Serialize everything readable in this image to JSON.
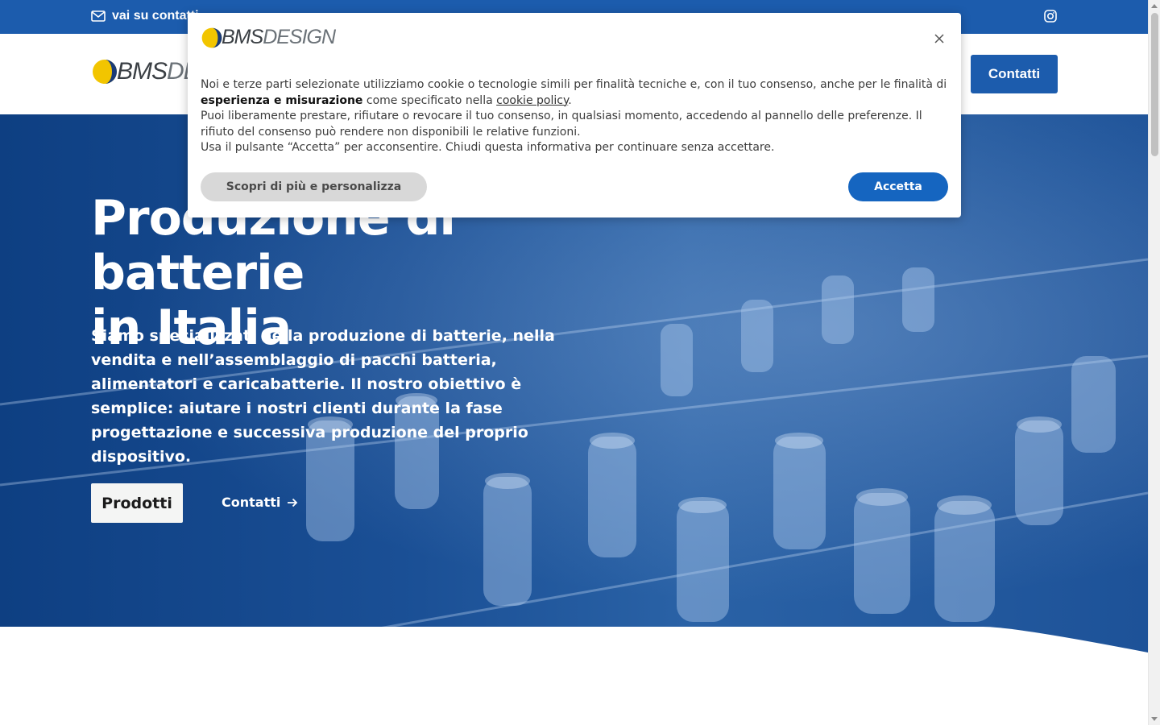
{
  "topbar": {
    "contact_label": "vai su contatti",
    "contact_icon": "envelope-icon",
    "social_icon": "instagram-icon"
  },
  "header": {
    "logo_text_bold": "BMS",
    "logo_text_light": "DESIGN",
    "cta_label": "Contatti"
  },
  "hero": {
    "title_line1": "Produzione di batterie",
    "title_line2": "in Italia",
    "lead": "Siamo specializzati nella produzione di batterie, nella vendita e nell’assemblaggio di pacchi batteria, alimentatori e caricabatterie. Il nostro obiettivo è semplice: aiutare i nostri clienti durante la fase progettazione e successiva produzione del proprio dispositivo.",
    "primary_button": "Prodotti",
    "secondary_link": "Contatti",
    "secondary_icon": "arrow-right-icon"
  },
  "cookie_banner": {
    "logo_text_bold": "BMS",
    "logo_text_light": "DESIGN",
    "close_icon": "close-icon",
    "text_part1": "Noi e terze parti selezionate utilizziamo cookie o tecnologie simili per finalità tecniche e, con il tuo consenso, anche per le finalità di ",
    "text_bold": "esperienza e misurazione",
    "text_part2": " come specificato nella ",
    "text_link": "cookie policy",
    "text_part3": ".",
    "text_line2": "Puoi liberamente prestare, rifiutare o revocare il tuo consenso, in qualsiasi momento, accedendo al pannello delle preferenze. Il rifiuto del consenso può rendere non disponibili le relative funzioni.",
    "text_line3": "Usa il pulsante “Accetta” per acconsentire. Chiudi questa informativa per continuare senza accettare.",
    "more_button": "Scopri di più e personalizza",
    "accept_button": "Accetta"
  },
  "colors": {
    "brand_blue": "#1c5cad",
    "accept_blue": "#1565c0",
    "logo_yellow": "#f2c500",
    "logo_navy": "#1a3b78"
  }
}
